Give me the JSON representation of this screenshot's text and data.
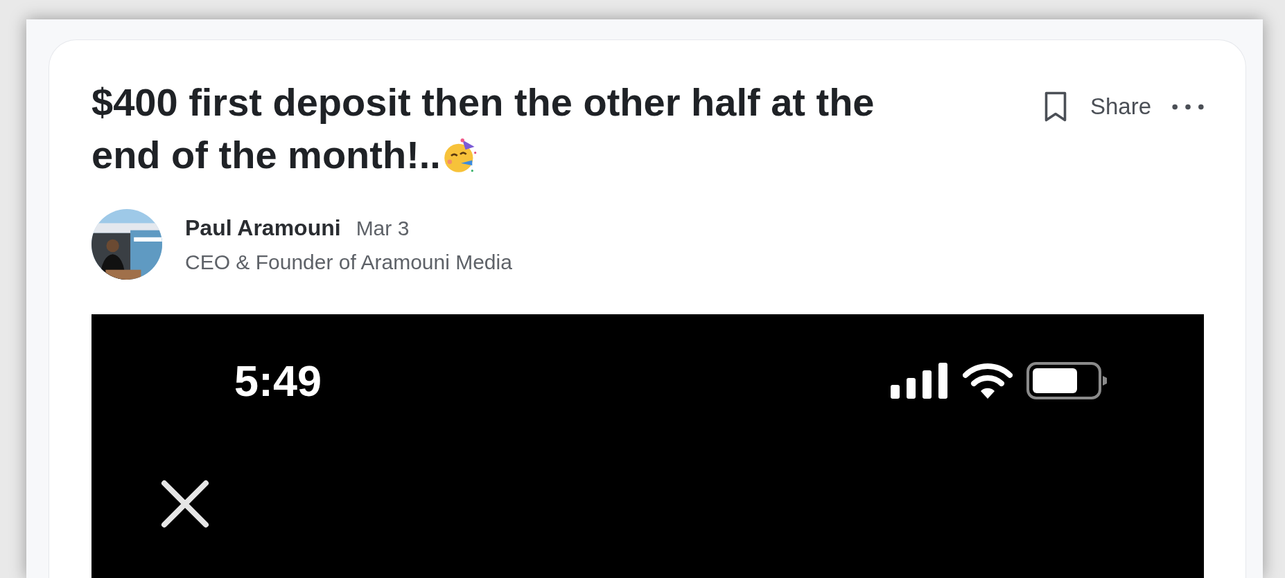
{
  "post": {
    "title_lines": [
      "$400 first deposit then the other half at the",
      "end of the month!.."
    ],
    "actions": {
      "bookmark": {
        "selected": false
      },
      "share": "Share"
    },
    "author": {
      "name": "Paul Aramouni",
      "date": "Mar 3",
      "headline": "CEO & Founder of Aramouni Media"
    },
    "image": {
      "kind": "screenshot",
      "status_bar": {
        "time": "5:49"
      }
    }
  }
}
